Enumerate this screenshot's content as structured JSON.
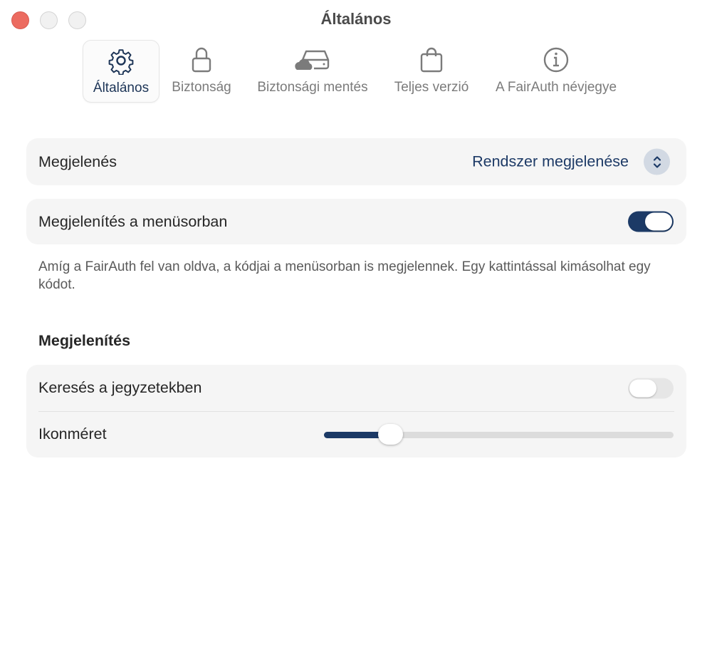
{
  "window": {
    "title": "Általános"
  },
  "toolbar": {
    "items": [
      {
        "label": "Általános",
        "icon": "gear-icon",
        "selected": true
      },
      {
        "label": "Biztonság",
        "icon": "lock-icon",
        "selected": false
      },
      {
        "label": "Biztonsági mentés",
        "icon": "cloud-drive-icon",
        "selected": false
      },
      {
        "label": "Teljes verzió",
        "icon": "shopping-bag-icon",
        "selected": false
      },
      {
        "label": "A FairAuth névjegye",
        "icon": "info-icon",
        "selected": false
      }
    ]
  },
  "appearance": {
    "label": "Megjelenés",
    "value": "Rendszer megjelenése"
  },
  "menubar": {
    "label": "Megjelenítés a menüsorban",
    "enabled": true,
    "help": "Amíg a FairAuth fel van oldva, a kódjai a menüsorban is megjelennek. Egy kattintással kimásolhat egy kódot."
  },
  "display": {
    "section_title": "Megjelenítés",
    "search_notes_label": "Keresés a jegyzetekben",
    "search_notes_enabled": false,
    "icon_size_label": "Ikonméret",
    "icon_size_fraction": 0.19
  },
  "colors": {
    "accent": "#1c3a66",
    "close_button": "#ec6b60"
  }
}
